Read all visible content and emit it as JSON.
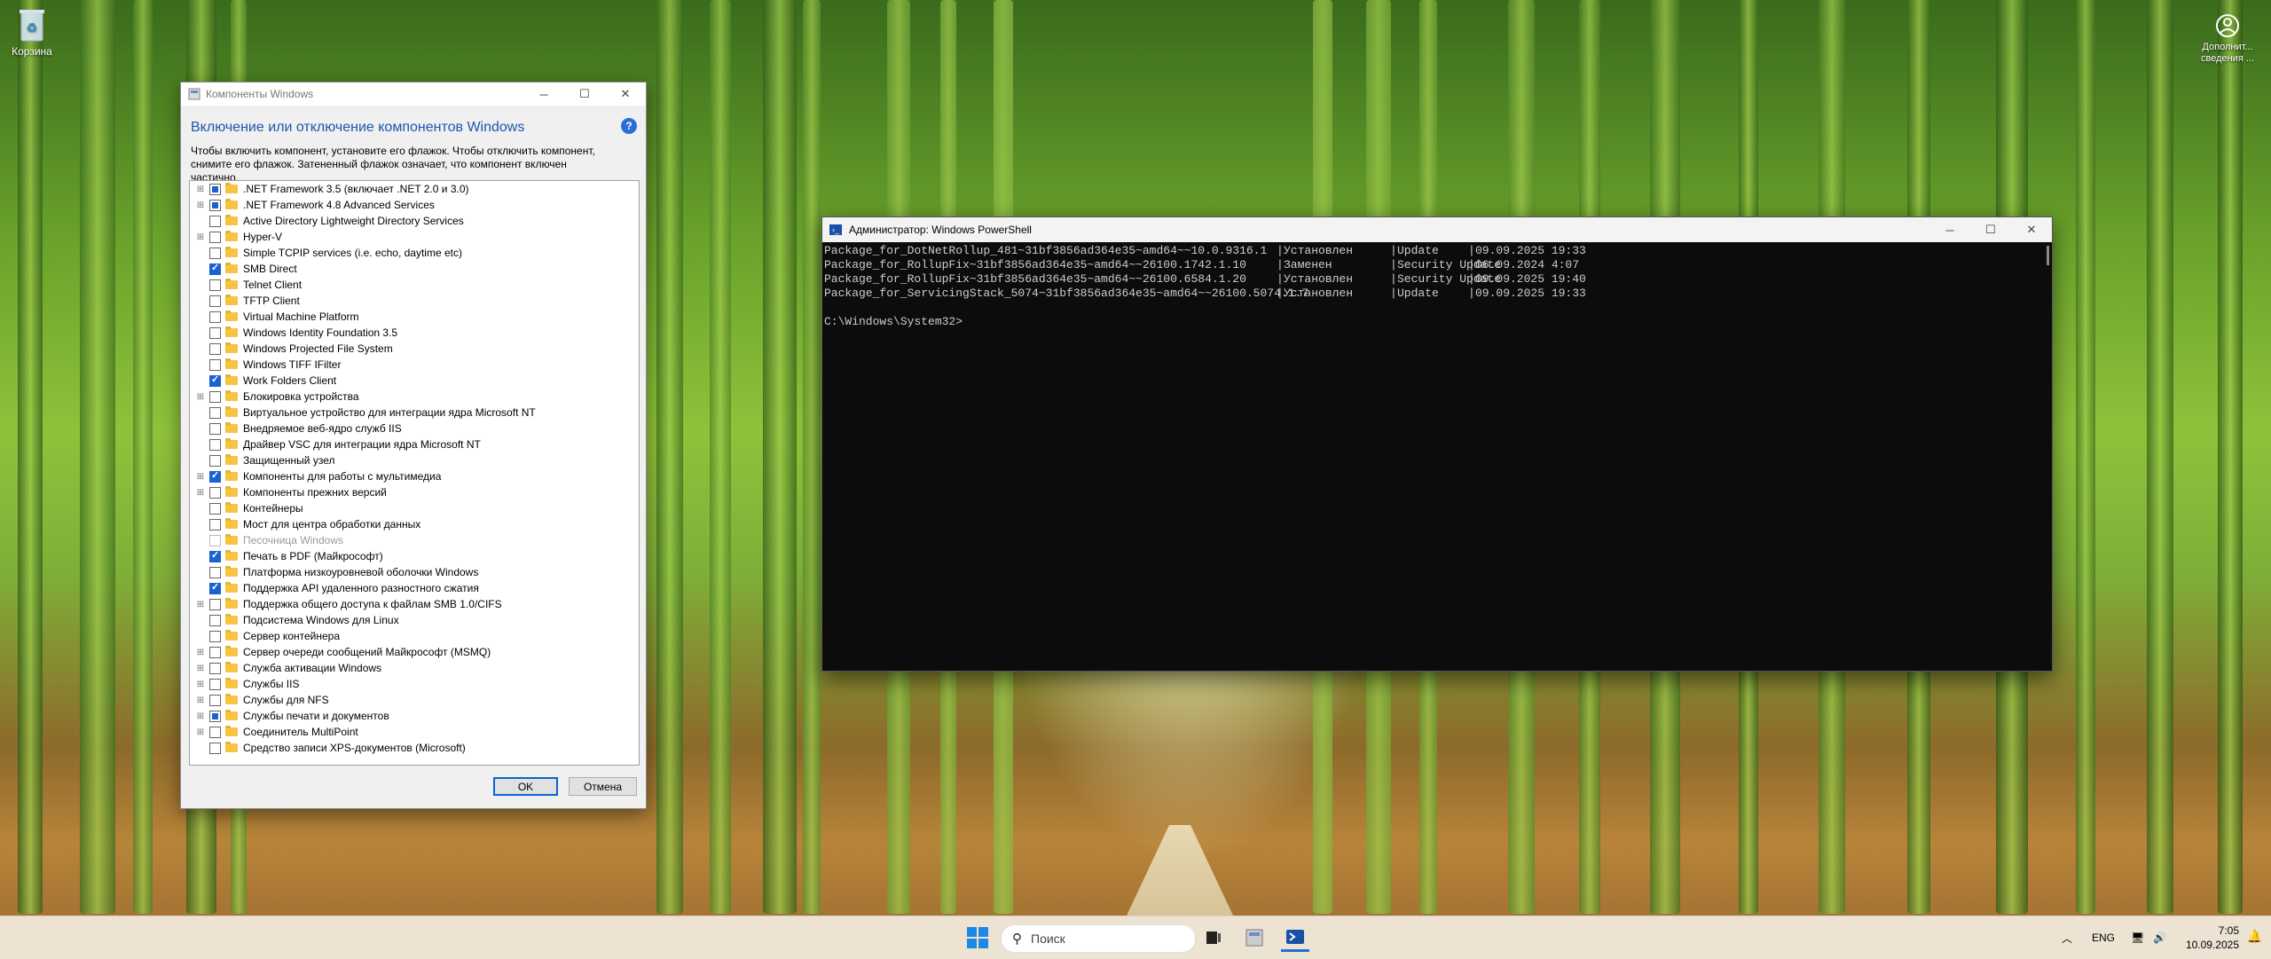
{
  "desktop": {
    "recycle_bin_label": "Корзина",
    "extra_icon_label": "Дополнит... сведения ..."
  },
  "features_dialog": {
    "title": "Компоненты Windows",
    "heading": "Включение или отключение компонентов Windows",
    "description": "Чтобы включить компонент, установите его флажок. Чтобы отключить компонент, снимите его флажок. Затененный флажок означает, что компонент включен частично.",
    "ok_label": "OK",
    "cancel_label": "Отмена",
    "items": [
      {
        "label": ".NET Framework 3.5 (включает .NET 2.0 и 3.0)",
        "expandable": true,
        "state": "partial"
      },
      {
        "label": ".NET Framework 4.8 Advanced Services",
        "expandable": true,
        "state": "partial"
      },
      {
        "label": "Active Directory Lightweight Directory Services",
        "expandable": false,
        "state": "unchecked"
      },
      {
        "label": "Hyper-V",
        "expandable": true,
        "state": "unchecked"
      },
      {
        "label": "Simple TCPIP services (i.e. echo, daytime etc)",
        "expandable": false,
        "state": "unchecked"
      },
      {
        "label": "SMB Direct",
        "expandable": false,
        "state": "checked"
      },
      {
        "label": "Telnet Client",
        "expandable": false,
        "state": "unchecked"
      },
      {
        "label": "TFTP Client",
        "expandable": false,
        "state": "unchecked"
      },
      {
        "label": "Virtual Machine Platform",
        "expandable": false,
        "state": "unchecked"
      },
      {
        "label": "Windows Identity Foundation 3.5",
        "expandable": false,
        "state": "unchecked"
      },
      {
        "label": "Windows Projected File System",
        "expandable": false,
        "state": "unchecked"
      },
      {
        "label": "Windows TIFF IFilter",
        "expandable": false,
        "state": "unchecked"
      },
      {
        "label": "Work Folders Client",
        "expandable": false,
        "state": "checked"
      },
      {
        "label": "Блокировка устройства",
        "expandable": true,
        "state": "unchecked"
      },
      {
        "label": "Виртуальное устройство для интеграции ядра Microsoft NT",
        "expandable": false,
        "state": "unchecked"
      },
      {
        "label": "Внедряемое веб-ядро служб IIS",
        "expandable": false,
        "state": "unchecked"
      },
      {
        "label": "Драйвер VSC для интеграции ядра Microsoft NT",
        "expandable": false,
        "state": "unchecked"
      },
      {
        "label": "Защищенный узел",
        "expandable": false,
        "state": "unchecked"
      },
      {
        "label": "Компоненты для работы с мультимедиа",
        "expandable": true,
        "state": "checked"
      },
      {
        "label": "Компоненты прежних версий",
        "expandable": true,
        "state": "unchecked"
      },
      {
        "label": "Контейнеры",
        "expandable": false,
        "state": "unchecked"
      },
      {
        "label": "Мост для центра обработки данных",
        "expandable": false,
        "state": "unchecked"
      },
      {
        "label": "Песочница Windows",
        "expandable": false,
        "state": "disabled"
      },
      {
        "label": "Печать в PDF (Майкрософт)",
        "expandable": false,
        "state": "checked"
      },
      {
        "label": "Платформа низкоуровневой оболочки Windows",
        "expandable": false,
        "state": "unchecked"
      },
      {
        "label": "Поддержка API удаленного разностного сжатия",
        "expandable": false,
        "state": "checked"
      },
      {
        "label": "Поддержка общего доступа к файлам SMB 1.0/CIFS",
        "expandable": true,
        "state": "unchecked"
      },
      {
        "label": "Подсистема Windows для Linux",
        "expandable": false,
        "state": "unchecked"
      },
      {
        "label": "Сервер контейнера",
        "expandable": false,
        "state": "unchecked"
      },
      {
        "label": "Сервер очереди сообщений Майкрософт (MSMQ)",
        "expandable": true,
        "state": "unchecked"
      },
      {
        "label": "Служба активации Windows",
        "expandable": true,
        "state": "unchecked"
      },
      {
        "label": "Службы IIS",
        "expandable": true,
        "state": "unchecked"
      },
      {
        "label": "Службы для NFS",
        "expandable": true,
        "state": "unchecked"
      },
      {
        "label": "Службы печати и документов",
        "expandable": true,
        "state": "partial"
      },
      {
        "label": "Соединитель MultiPoint",
        "expandable": true,
        "state": "unchecked"
      },
      {
        "label": "Средство записи XPS-документов (Microsoft)",
        "expandable": false,
        "state": "unchecked"
      }
    ]
  },
  "powershell": {
    "title": "Администратор: Windows PowerShell",
    "rows": [
      {
        "package": "Package_for_DotNetRollup_481~31bf3856ad364e35~amd64~~10.0.9316.1",
        "state": "Установлен",
        "type": "Update",
        "date": "09.09.2025 19:33"
      },
      {
        "package": "Package_for_RollupFix~31bf3856ad364e35~amd64~~26100.1742.1.10",
        "state": "Заменен",
        "type": "Security Update",
        "date": "06.09.2024 4:07"
      },
      {
        "package": "Package_for_RollupFix~31bf3856ad364e35~amd64~~26100.6584.1.20",
        "state": "Установлен",
        "type": "Security Update",
        "date": "09.09.2025 19:40"
      },
      {
        "package": "Package_for_ServicingStack_5074~31bf3856ad364e35~amd64~~26100.5074.1.7",
        "state": "Установлен",
        "type": "Update",
        "date": "09.09.2025 19:33"
      }
    ],
    "prompt": "C:\\Windows\\System32>"
  },
  "taskbar": {
    "search_placeholder": "Поиск",
    "language": "ENG",
    "time": "7:05",
    "date": "10.09.2025"
  }
}
